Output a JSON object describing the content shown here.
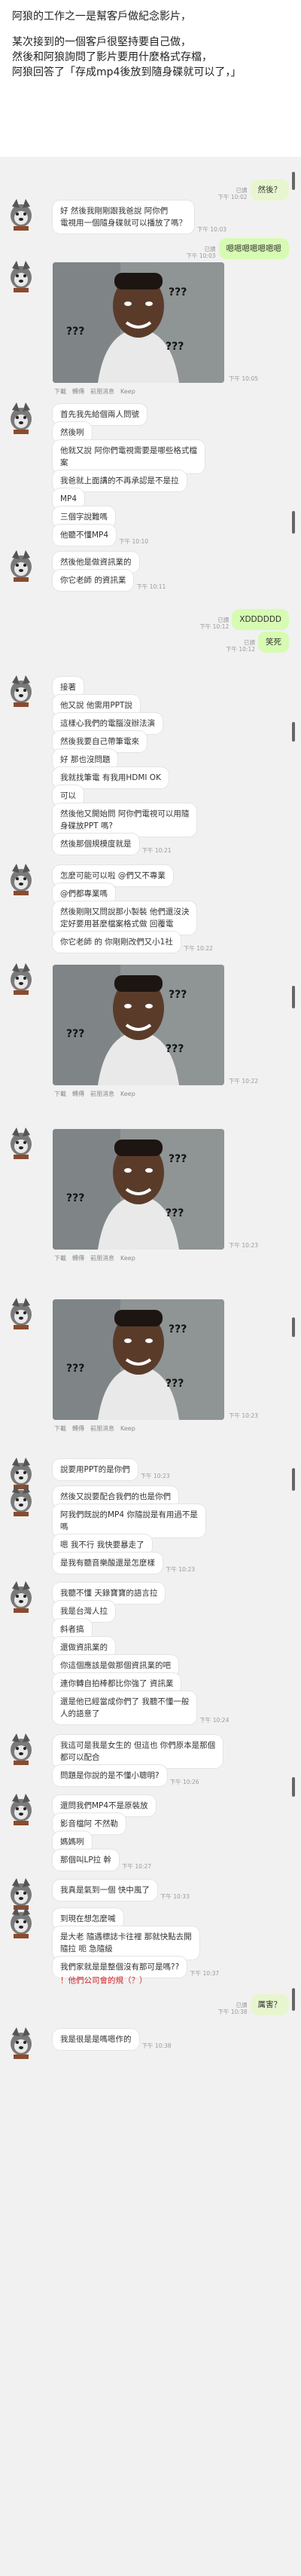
{
  "intro": {
    "line1": "阿狼的工作之一是幫客戶做紀念影片，",
    "line2": "某次接到的一個客戶很堅持要自己做，",
    "line3": "然後和阿狼詢問了影片要用什麼格式存檔，",
    "line4": "阿狼回答了「存成mp4後放到隨身碟就可以了，」"
  },
  "chat": {
    "seen_label": "已讀",
    "keep_actions": [
      "下載",
      "轉傳",
      "前朋消息",
      "Keep"
    ],
    "meme_text": "???",
    "messages": [
      {
        "id": "m1",
        "side": "out",
        "text": "然後？",
        "time": "已讀\n下午 10:02"
      },
      {
        "id": "m2",
        "side": "in",
        "text": "好 然後我剛剛跟我爸說 阿你們\n電視用一個隨身碟就可以播放了嗎？",
        "time": "下午 10:03"
      },
      {
        "id": "m3",
        "side": "out",
        "text": "嗯嗯嗯嗯嗯嗯嗯",
        "time": "已讀\n下午 10:03"
      },
      {
        "id": "m4",
        "side": "in",
        "type": "photo",
        "time": "下午 10:05"
      },
      {
        "id": "m5",
        "side": "in",
        "text": "首先我先給個兩人問號",
        "time": ""
      },
      {
        "id": "m6",
        "side": "in",
        "text": "然後咧",
        "time": ""
      },
      {
        "id": "m7",
        "side": "in",
        "text": "他就又說 阿你們電視需要是哪些格式檔\n案",
        "time": ""
      },
      {
        "id": "m8",
        "side": "in",
        "text": "我爸就上面講的不再承認是不是拉",
        "time": ""
      },
      {
        "id": "m9",
        "side": "in",
        "text": "MP4",
        "time": ""
      },
      {
        "id": "m10",
        "side": "in",
        "text": "三個字說難嗎",
        "time": ""
      },
      {
        "id": "m11",
        "side": "in",
        "text": "他聽不懂MP4",
        "time": "下午 10:10"
      },
      {
        "id": "m12",
        "side": "in",
        "text": "然後他是做資訊業的",
        "time": ""
      },
      {
        "id": "m13",
        "side": "in",
        "text": "你它老師 的資訊業",
        "time": "下午 10:11"
      },
      {
        "id": "m14",
        "side": "out",
        "text": "XDDDDDD",
        "time": "已讀\n下午 10:12"
      },
      {
        "id": "m15",
        "side": "out",
        "text": "笑死",
        "time": "已讀\n下午 10:12"
      },
      {
        "id": "m16",
        "side": "in",
        "text": "接著",
        "time": ""
      },
      {
        "id": "m17",
        "side": "in",
        "text": "他又說 他需用PPT說",
        "time": ""
      },
      {
        "id": "m18",
        "side": "in",
        "text": "這樣心我們的電腦沒辦法演",
        "time": ""
      },
      {
        "id": "m19",
        "side": "in",
        "text": "然後我要自己帶筆電來",
        "time": ""
      },
      {
        "id": "m20",
        "side": "in",
        "text": "好 那也沒問題",
        "time": ""
      },
      {
        "id": "m21",
        "side": "in",
        "text": "我就找筆電 有我用HDMI OK",
        "time": ""
      },
      {
        "id": "m22",
        "side": "in",
        "text": "可以",
        "time": ""
      },
      {
        "id": "m23",
        "side": "in",
        "text": "然後他又開始問 阿你們電視可以用隨\n身碟放PPT 嗎?",
        "time": ""
      },
      {
        "id": "m24",
        "side": "in",
        "text": "然後那個規模度就是",
        "time": "下午 10:21"
      },
      {
        "id": "m25",
        "side": "in",
        "text": "怎麼可能可以啦 @們又不專業",
        "time": ""
      },
      {
        "id": "m26",
        "side": "in",
        "text": "@們都專業嗎",
        "time": ""
      },
      {
        "id": "m27",
        "side": "in",
        "text": "然後剛剛又問說那小製裝 他們還沒決\n定好要用甚麼檔案格式做 回覆電",
        "time": ""
      },
      {
        "id": "m28",
        "side": "in",
        "text": "你它老師 的 你剛剛改們又小1社",
        "time": "下午 10:22"
      },
      {
        "id": "m29",
        "side": "in",
        "type": "photo",
        "time": "下午 10:22"
      },
      {
        "id": "m30",
        "side": "in",
        "type": "photo",
        "time": "下午 10:23"
      },
      {
        "id": "m31",
        "side": "in",
        "type": "photo",
        "time": "下午 10:23"
      },
      {
        "id": "m32",
        "side": "in",
        "text": "說要用PPT的是你們",
        "time": "下午 10:23"
      },
      {
        "id": "m33",
        "side": "in",
        "text": "然後又說要配合我們的也是你們",
        "time": ""
      },
      {
        "id": "m34",
        "side": "in",
        "text": "阿我們既說的MP4 你隨說是有用過不是\n嗎",
        "time": ""
      },
      {
        "id": "m35",
        "side": "in",
        "text": "嗯 我不行 我快要暴走了",
        "time": ""
      },
      {
        "id": "m36",
        "side": "in",
        "text": "是我有聽音樂酸還是怎麼樣",
        "time": "下午 10:23"
      },
      {
        "id": "m37",
        "side": "in",
        "text": "我聽不懂 天錄寶寶的語言拉",
        "time": ""
      },
      {
        "id": "m38",
        "side": "in",
        "text": "我是台灣人拉",
        "time": ""
      },
      {
        "id": "m39",
        "side": "in",
        "text": "斜者搞",
        "time": ""
      },
      {
        "id": "m40",
        "side": "in",
        "text": "還做資訊業的",
        "time": ""
      },
      {
        "id": "m41",
        "side": "in",
        "text": "你這個應該是做那個資訊業的吧",
        "time": ""
      },
      {
        "id": "m42",
        "side": "in",
        "text": "連你轉自拍棒都比你強了 資訊業",
        "time": ""
      },
      {
        "id": "m43",
        "side": "in",
        "text": "還是他已經當成你們了 我聽不懂一般\n人的語意了",
        "time": "下午 10:24"
      },
      {
        "id": "m44",
        "side": "in",
        "text": "我這可是我是女生的 但這也 你們原本是那個\n都可以配合",
        "time": ""
      },
      {
        "id": "m45",
        "side": "in",
        "text": "問題是你說的是不懂小聰明?",
        "time": "下午 10:26"
      },
      {
        "id": "m46",
        "side": "in",
        "text": "還問我們MP4不是原裝放",
        "time": ""
      },
      {
        "id": "m47",
        "side": "in",
        "text": "影音檔阿 不然勒",
        "time": ""
      },
      {
        "id": "m48",
        "side": "in",
        "text": "媽媽咧",
        "time": ""
      },
      {
        "id": "m49",
        "side": "in",
        "text": "那個叫LP拉 幹",
        "time": "下午 10:27"
      },
      {
        "id": "m50",
        "side": "in",
        "text": "我真是氣到一個 快中風了",
        "time": "下午 10:33"
      },
      {
        "id": "m51",
        "side": "in",
        "text": "到現在想怎麼喊",
        "time": ""
      },
      {
        "id": "m52",
        "side": "in",
        "text": "是大老 隨遇標誌卡往裡 那就快點去開\n隨拉 呃 急隨級",
        "time": ""
      },
      {
        "id": "m53",
        "side": "in",
        "text": "我們家就是是整個沒有那可是嗎??",
        "time": "下午 10:37"
      },
      {
        "id": "m54",
        "side": "in",
        "text": "！他們公司會的規（？）",
        "time": ""
      },
      {
        "id": "m55",
        "side": "out",
        "text": "厲害？",
        "time": "已讀\n下午 10:38"
      },
      {
        "id": "m56",
        "side": "in",
        "text": "我是很是是嗎嗯作的",
        "time": "下午 10:38"
      }
    ]
  }
}
